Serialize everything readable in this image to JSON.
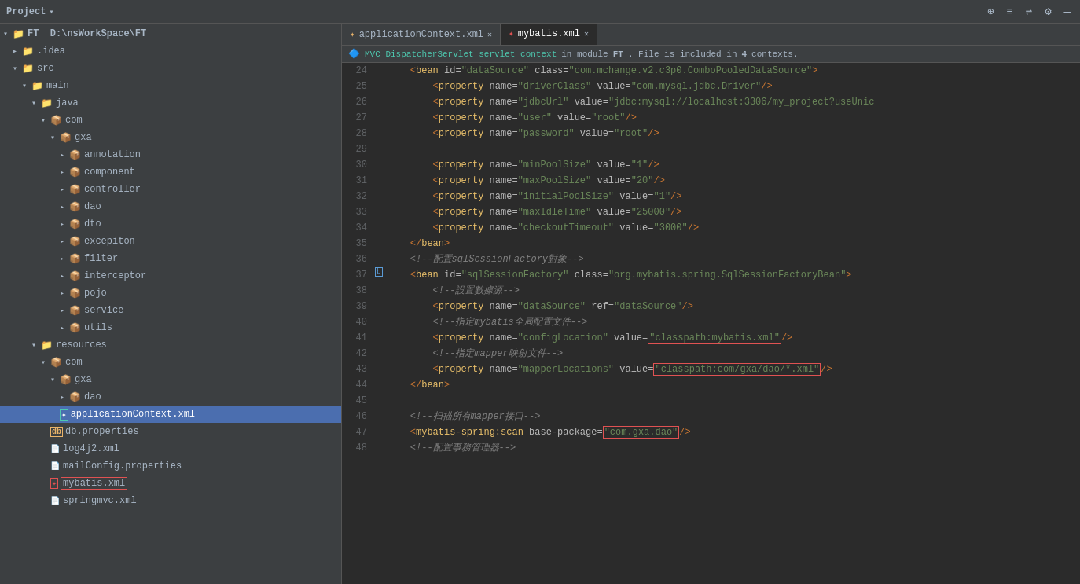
{
  "topbar": {
    "title": "Project",
    "icons": [
      "⊕",
      "≡",
      "⇌",
      "⚙",
      "—"
    ]
  },
  "sidebar": {
    "root": "FT  D:\\nsWorkSpace\\FT",
    "items": [
      {
        "id": "idea",
        "label": ".idea",
        "depth": 1,
        "type": "folder",
        "expanded": false
      },
      {
        "id": "src",
        "label": "src",
        "depth": 1,
        "type": "folder",
        "expanded": true
      },
      {
        "id": "main",
        "label": "main",
        "depth": 2,
        "type": "folder",
        "expanded": true
      },
      {
        "id": "java",
        "label": "java",
        "depth": 3,
        "type": "folder-src",
        "expanded": true
      },
      {
        "id": "com",
        "label": "com",
        "depth": 4,
        "type": "package",
        "expanded": true
      },
      {
        "id": "gxa",
        "label": "gxa",
        "depth": 5,
        "type": "package",
        "expanded": true
      },
      {
        "id": "annotation",
        "label": "annotation",
        "depth": 6,
        "type": "package-closed"
      },
      {
        "id": "component",
        "label": "component",
        "depth": 6,
        "type": "package-closed"
      },
      {
        "id": "controller",
        "label": "controller",
        "depth": 6,
        "type": "package-closed"
      },
      {
        "id": "dao",
        "label": "dao",
        "depth": 6,
        "type": "package-closed"
      },
      {
        "id": "dto",
        "label": "dto",
        "depth": 6,
        "type": "package-closed"
      },
      {
        "id": "excepiton",
        "label": "excepiton",
        "depth": 6,
        "type": "package-closed"
      },
      {
        "id": "filter",
        "label": "filter",
        "depth": 6,
        "type": "package-closed"
      },
      {
        "id": "interceptor",
        "label": "interceptor",
        "depth": 6,
        "type": "package-closed"
      },
      {
        "id": "pojo",
        "label": "pojo",
        "depth": 6,
        "type": "package-closed"
      },
      {
        "id": "service",
        "label": "service",
        "depth": 6,
        "type": "package-closed"
      },
      {
        "id": "utils",
        "label": "utils",
        "depth": 6,
        "type": "package-closed"
      },
      {
        "id": "resources",
        "label": "resources",
        "depth": 3,
        "type": "folder-res",
        "expanded": true
      },
      {
        "id": "res-com",
        "label": "com",
        "depth": 4,
        "type": "package",
        "expanded": true
      },
      {
        "id": "res-gxa",
        "label": "gxa",
        "depth": 5,
        "type": "package",
        "expanded": true
      },
      {
        "id": "res-dao",
        "label": "dao",
        "depth": 6,
        "type": "package-closed"
      },
      {
        "id": "applicationContext",
        "label": "applicationContext.xml",
        "depth": 5,
        "type": "xml-spring",
        "selected": true
      },
      {
        "id": "db-properties",
        "label": "db.properties",
        "depth": 4,
        "type": "properties"
      },
      {
        "id": "log4j2",
        "label": "log4j2.xml",
        "depth": 4,
        "type": "xml"
      },
      {
        "id": "mailConfig",
        "label": "mailConfig.properties",
        "depth": 4,
        "type": "properties"
      },
      {
        "id": "mybatis",
        "label": "mybatis.xml",
        "depth": 4,
        "type": "xml-red"
      },
      {
        "id": "springmvc",
        "label": "springmvc.xml",
        "depth": 4,
        "type": "xml"
      }
    ]
  },
  "tabs": [
    {
      "id": "applicationContext",
      "label": "applicationContext.xml",
      "active": false,
      "type": "xml-spring"
    },
    {
      "id": "mybatis",
      "label": "mybatis.xml",
      "active": true,
      "type": "xml-red"
    }
  ],
  "context_bar": {
    "icon": "🔷",
    "link_text": "MVC DispatcherServlet servlet context",
    "middle_text": "in module",
    "bold_text": "FT",
    "end_text": ". File is included in",
    "count": "4",
    "suffix": "contexts."
  },
  "lines": [
    {
      "num": 24,
      "gutter": "",
      "content": [
        {
          "type": "kw",
          "text": "    <"
        },
        {
          "type": "tag",
          "text": "bean"
        },
        {
          "type": "attr",
          "text": " id="
        },
        {
          "type": "val",
          "text": "\"dataSource\""
        },
        {
          "type": "attr",
          "text": " class="
        },
        {
          "type": "val",
          "text": "\"com.mchange.v2.c3p0.ComboPooledDataSource\""
        },
        {
          "type": "kw",
          "text": ">"
        }
      ]
    },
    {
      "num": 25,
      "gutter": "",
      "content": [
        {
          "type": "kw",
          "text": "        <"
        },
        {
          "type": "tag",
          "text": "property"
        },
        {
          "type": "attr",
          "text": " name="
        },
        {
          "type": "val",
          "text": "\"driverClass\""
        },
        {
          "type": "attr",
          "text": " value="
        },
        {
          "type": "val",
          "text": "\"com.mysql.jdbc.Driver\""
        },
        {
          "type": "kw",
          "text": "/>"
        }
      ]
    },
    {
      "num": 26,
      "gutter": "",
      "content": [
        {
          "type": "kw",
          "text": "        <"
        },
        {
          "type": "tag",
          "text": "property"
        },
        {
          "type": "attr",
          "text": " name="
        },
        {
          "type": "val",
          "text": "\"jdbcUrl\""
        },
        {
          "type": "attr",
          "text": " value="
        },
        {
          "type": "val",
          "text": "\"jdbc:mysql://localhost:3306/my_project?useUnic"
        },
        {
          "type": "kw",
          "text": ""
        }
      ]
    },
    {
      "num": 27,
      "gutter": "",
      "content": [
        {
          "type": "kw",
          "text": "        <"
        },
        {
          "type": "tag",
          "text": "property"
        },
        {
          "type": "attr",
          "text": " name="
        },
        {
          "type": "val",
          "text": "\"user\""
        },
        {
          "type": "attr",
          "text": " value="
        },
        {
          "type": "val",
          "text": "\"root\""
        },
        {
          "type": "kw",
          "text": "/>"
        }
      ]
    },
    {
      "num": 28,
      "gutter": "",
      "content": [
        {
          "type": "kw",
          "text": "        <"
        },
        {
          "type": "tag",
          "text": "property"
        },
        {
          "type": "attr",
          "text": " name="
        },
        {
          "type": "val",
          "text": "\"password\""
        },
        {
          "type": "attr",
          "text": " value="
        },
        {
          "type": "val",
          "text": "\"root\""
        },
        {
          "type": "kw",
          "text": "/>"
        }
      ]
    },
    {
      "num": 29,
      "gutter": "",
      "content": []
    },
    {
      "num": 30,
      "gutter": "",
      "content": [
        {
          "type": "kw",
          "text": "        <"
        },
        {
          "type": "tag",
          "text": "property"
        },
        {
          "type": "attr",
          "text": " name="
        },
        {
          "type": "val",
          "text": "\"minPoolSize\""
        },
        {
          "type": "attr",
          "text": " value="
        },
        {
          "type": "val",
          "text": "\"1\""
        },
        {
          "type": "kw",
          "text": "/>"
        }
      ]
    },
    {
      "num": 31,
      "gutter": "",
      "content": [
        {
          "type": "kw",
          "text": "        <"
        },
        {
          "type": "tag",
          "text": "property"
        },
        {
          "type": "attr",
          "text": " name="
        },
        {
          "type": "val",
          "text": "\"maxPoolSize\""
        },
        {
          "type": "attr",
          "text": " value="
        },
        {
          "type": "val",
          "text": "\"20\""
        },
        {
          "type": "kw",
          "text": "/>"
        }
      ]
    },
    {
      "num": 32,
      "gutter": "",
      "content": [
        {
          "type": "kw",
          "text": "        <"
        },
        {
          "type": "tag",
          "text": "property"
        },
        {
          "type": "attr",
          "text": " name="
        },
        {
          "type": "val",
          "text": "\"initialPoolSize\""
        },
        {
          "type": "attr",
          "text": " value="
        },
        {
          "type": "val",
          "text": "\"1\""
        },
        {
          "type": "kw",
          "text": "/>"
        }
      ]
    },
    {
      "num": 33,
      "gutter": "",
      "content": [
        {
          "type": "kw",
          "text": "        <"
        },
        {
          "type": "tag",
          "text": "property"
        },
        {
          "type": "attr",
          "text": " name="
        },
        {
          "type": "val",
          "text": "\"maxIdleTime\""
        },
        {
          "type": "attr",
          "text": " value="
        },
        {
          "type": "val",
          "text": "\"25000\""
        },
        {
          "type": "kw",
          "text": "/>"
        }
      ]
    },
    {
      "num": 34,
      "gutter": "",
      "content": [
        {
          "type": "kw",
          "text": "        <"
        },
        {
          "type": "tag",
          "text": "property"
        },
        {
          "type": "attr",
          "text": " name="
        },
        {
          "type": "val",
          "text": "\"checkoutTimeout\""
        },
        {
          "type": "attr",
          "text": " value="
        },
        {
          "type": "val",
          "text": "\"3000\""
        },
        {
          "type": "kw",
          "text": "/>"
        }
      ]
    },
    {
      "num": 35,
      "gutter": "",
      "content": [
        {
          "type": "kw",
          "text": "    </"
        },
        {
          "type": "tag",
          "text": "bean"
        },
        {
          "type": "kw",
          "text": ">"
        }
      ]
    },
    {
      "num": 36,
      "gutter": "",
      "content": [
        {
          "type": "comment",
          "text": "    <!--配置sqlSessionFactory對象-->"
        }
      ]
    },
    {
      "num": 37,
      "gutter": "bean",
      "content": [
        {
          "type": "kw",
          "text": "    <"
        },
        {
          "type": "tag",
          "text": "bean"
        },
        {
          "type": "attr",
          "text": " id="
        },
        {
          "type": "val",
          "text": "\"sqlSessionFactory\""
        },
        {
          "type": "attr",
          "text": " class="
        },
        {
          "type": "val",
          "text": "\"org.mybatis.spring.SqlSessionFactoryBean\""
        },
        {
          "type": "kw",
          "text": ">"
        }
      ]
    },
    {
      "num": 38,
      "gutter": "",
      "content": [
        {
          "type": "comment",
          "text": "        <!--設置數據源-->"
        }
      ]
    },
    {
      "num": 39,
      "gutter": "",
      "content": [
        {
          "type": "kw",
          "text": "        <"
        },
        {
          "type": "tag",
          "text": "property"
        },
        {
          "type": "attr",
          "text": " name="
        },
        {
          "type": "val",
          "text": "\"dataSource\""
        },
        {
          "type": "attr",
          "text": " ref="
        },
        {
          "type": "val",
          "text": "\"dataSource\""
        },
        {
          "type": "kw",
          "text": "/>"
        }
      ]
    },
    {
      "num": 40,
      "gutter": "",
      "content": [
        {
          "type": "comment",
          "text": "        <!--指定mybatis全局配置文件-->"
        }
      ]
    },
    {
      "num": 41,
      "gutter": "",
      "content": [
        {
          "type": "kw",
          "text": "        <"
        },
        {
          "type": "tag",
          "text": "property"
        },
        {
          "type": "attr",
          "text": " name="
        },
        {
          "type": "val",
          "text": "\"configLocation\""
        },
        {
          "type": "attr",
          "text": " value="
        },
        {
          "type": "val-highlight",
          "text": "\"classpath:mybatis.xml\""
        },
        {
          "type": "kw",
          "text": "/>"
        }
      ]
    },
    {
      "num": 42,
      "gutter": "",
      "content": [
        {
          "type": "comment",
          "text": "        <!--指定mapper映射文件-->"
        }
      ]
    },
    {
      "num": 43,
      "gutter": "",
      "content": [
        {
          "type": "kw",
          "text": "        <"
        },
        {
          "type": "tag",
          "text": "property"
        },
        {
          "type": "attr",
          "text": " name="
        },
        {
          "type": "val",
          "text": "\"mapperLocations\""
        },
        {
          "type": "attr",
          "text": " value="
        },
        {
          "type": "val-highlight2",
          "text": "\"classpath:com/gxa/dao/*.xml\""
        },
        {
          "type": "kw",
          "text": "/>"
        }
      ]
    },
    {
      "num": 44,
      "gutter": "",
      "content": [
        {
          "type": "kw",
          "text": "    </"
        },
        {
          "type": "tag",
          "text": "bean"
        },
        {
          "type": "kw",
          "text": ">"
        }
      ]
    },
    {
      "num": 45,
      "gutter": "",
      "content": []
    },
    {
      "num": 46,
      "gutter": "",
      "content": [
        {
          "type": "comment",
          "text": "    <!--扫描所有mapper接口-->"
        }
      ]
    },
    {
      "num": 47,
      "gutter": "",
      "content": [
        {
          "type": "kw",
          "text": "    <"
        },
        {
          "type": "tag",
          "text": "mybatis-spring:scan"
        },
        {
          "type": "attr",
          "text": " base-package="
        },
        {
          "type": "val-highlight3",
          "text": "\"com.gxa.dao\""
        },
        {
          "type": "kw",
          "text": "/>"
        }
      ]
    },
    {
      "num": 48,
      "gutter": "",
      "content": [
        {
          "type": "comment",
          "text": "    <!--配置事務管理器-->"
        }
      ]
    }
  ]
}
